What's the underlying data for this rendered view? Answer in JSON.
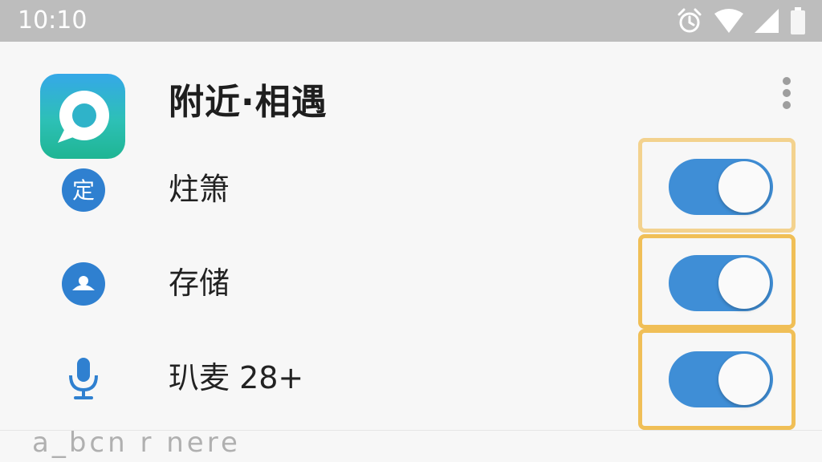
{
  "status_bar": {
    "time": "10:10",
    "icons": [
      "alarm-icon",
      "wifi-icon",
      "signal-icon",
      "battery-icon"
    ]
  },
  "app": {
    "title": "附近·相遇",
    "icon": "chat-bubble-icon",
    "brand_colors": [
      "#35a8e8",
      "#1fb593"
    ]
  },
  "settings": [
    {
      "label": "炷箫",
      "badge": "定",
      "icon": "location-badge-icon",
      "enabled": true
    },
    {
      "label": "存储",
      "icon": "storage-icon",
      "enabled": true
    },
    {
      "label": "玐麦 28+",
      "icon": "microphone-icon",
      "enabled": true
    }
  ],
  "footer_text": "a_bcn r nere",
  "colors": {
    "toggle_on": "#3f8ed6",
    "highlight_frame": "#f0bf57",
    "icon_blue": "#2f80d0"
  }
}
